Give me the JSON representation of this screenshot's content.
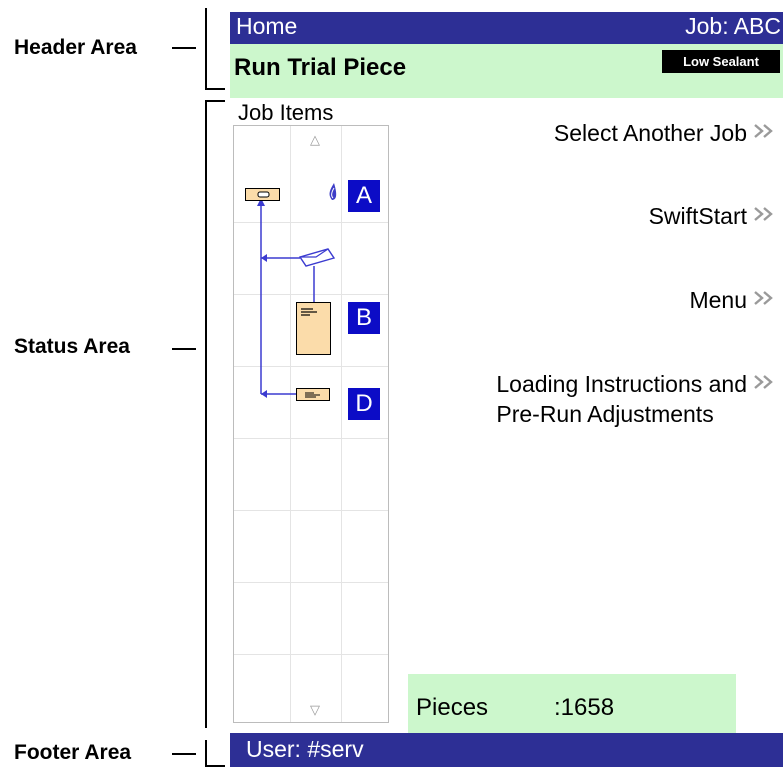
{
  "callouts": {
    "header": "Header Area",
    "status": "Status Area",
    "footer": "Footer Area"
  },
  "header": {
    "home_label": "Home",
    "job_label": "Job:  ABC",
    "title": "Run Trial Piece",
    "badge": "Low Sealant"
  },
  "job_items": {
    "label": "Job Items",
    "scroll_up": "△",
    "scroll_down": "▽",
    "tags": [
      "A",
      "B",
      "D"
    ]
  },
  "menu": {
    "items": [
      {
        "label_1": "Select Another Job",
        "label_2": ""
      },
      {
        "label_1": "SwiftStart",
        "label_2": ""
      },
      {
        "label_1": "Menu",
        "label_2": ""
      },
      {
        "label_1": "Loading Instructions and",
        "label_2": "Pre-Run Adjustments"
      }
    ]
  },
  "pieces": {
    "label": "Pieces",
    "value": ":1658"
  },
  "footer": {
    "user": "User: #serv"
  },
  "colors": {
    "header_bar": "#2d2f95",
    "header_green": "#ccf7cc",
    "tag_blue": "#0c0cc6",
    "item_fill": "#fbdcaa",
    "flow_line": "#3b3bd0"
  }
}
